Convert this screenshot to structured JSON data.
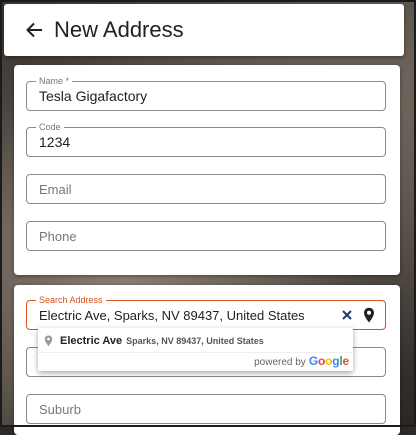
{
  "header": {
    "title": "New Address",
    "back_icon": "arrow-left-icon"
  },
  "form": {
    "name": {
      "label": "Name *",
      "value": "Tesla Gigafactory"
    },
    "code": {
      "label": "Code",
      "value": "1234"
    },
    "email": {
      "placeholder": "Email"
    },
    "phone": {
      "placeholder": "Phone"
    },
    "search_address": {
      "label": "Search Address",
      "value": "Electric Ave, Sparks, NV 89437, United States",
      "clear_icon": "close-icon",
      "location_icon": "map-pin-icon"
    },
    "suburb": {
      "placeholder": "Suburb"
    }
  },
  "autocomplete": {
    "suggestions": [
      {
        "main": "Electric Ave",
        "secondary": "Sparks, NV 89437, United States"
      }
    ],
    "powered_by": "powered by",
    "brand": [
      "G",
      "o",
      "o",
      "g",
      "l",
      "e"
    ],
    "brand_colors": [
      "#4285F4",
      "#EA4335",
      "#FBBC05",
      "#4285F4",
      "#34A853",
      "#EA4335"
    ]
  },
  "colors": {
    "accent": "#d9531e",
    "clear_icon": "#1f3b73"
  }
}
